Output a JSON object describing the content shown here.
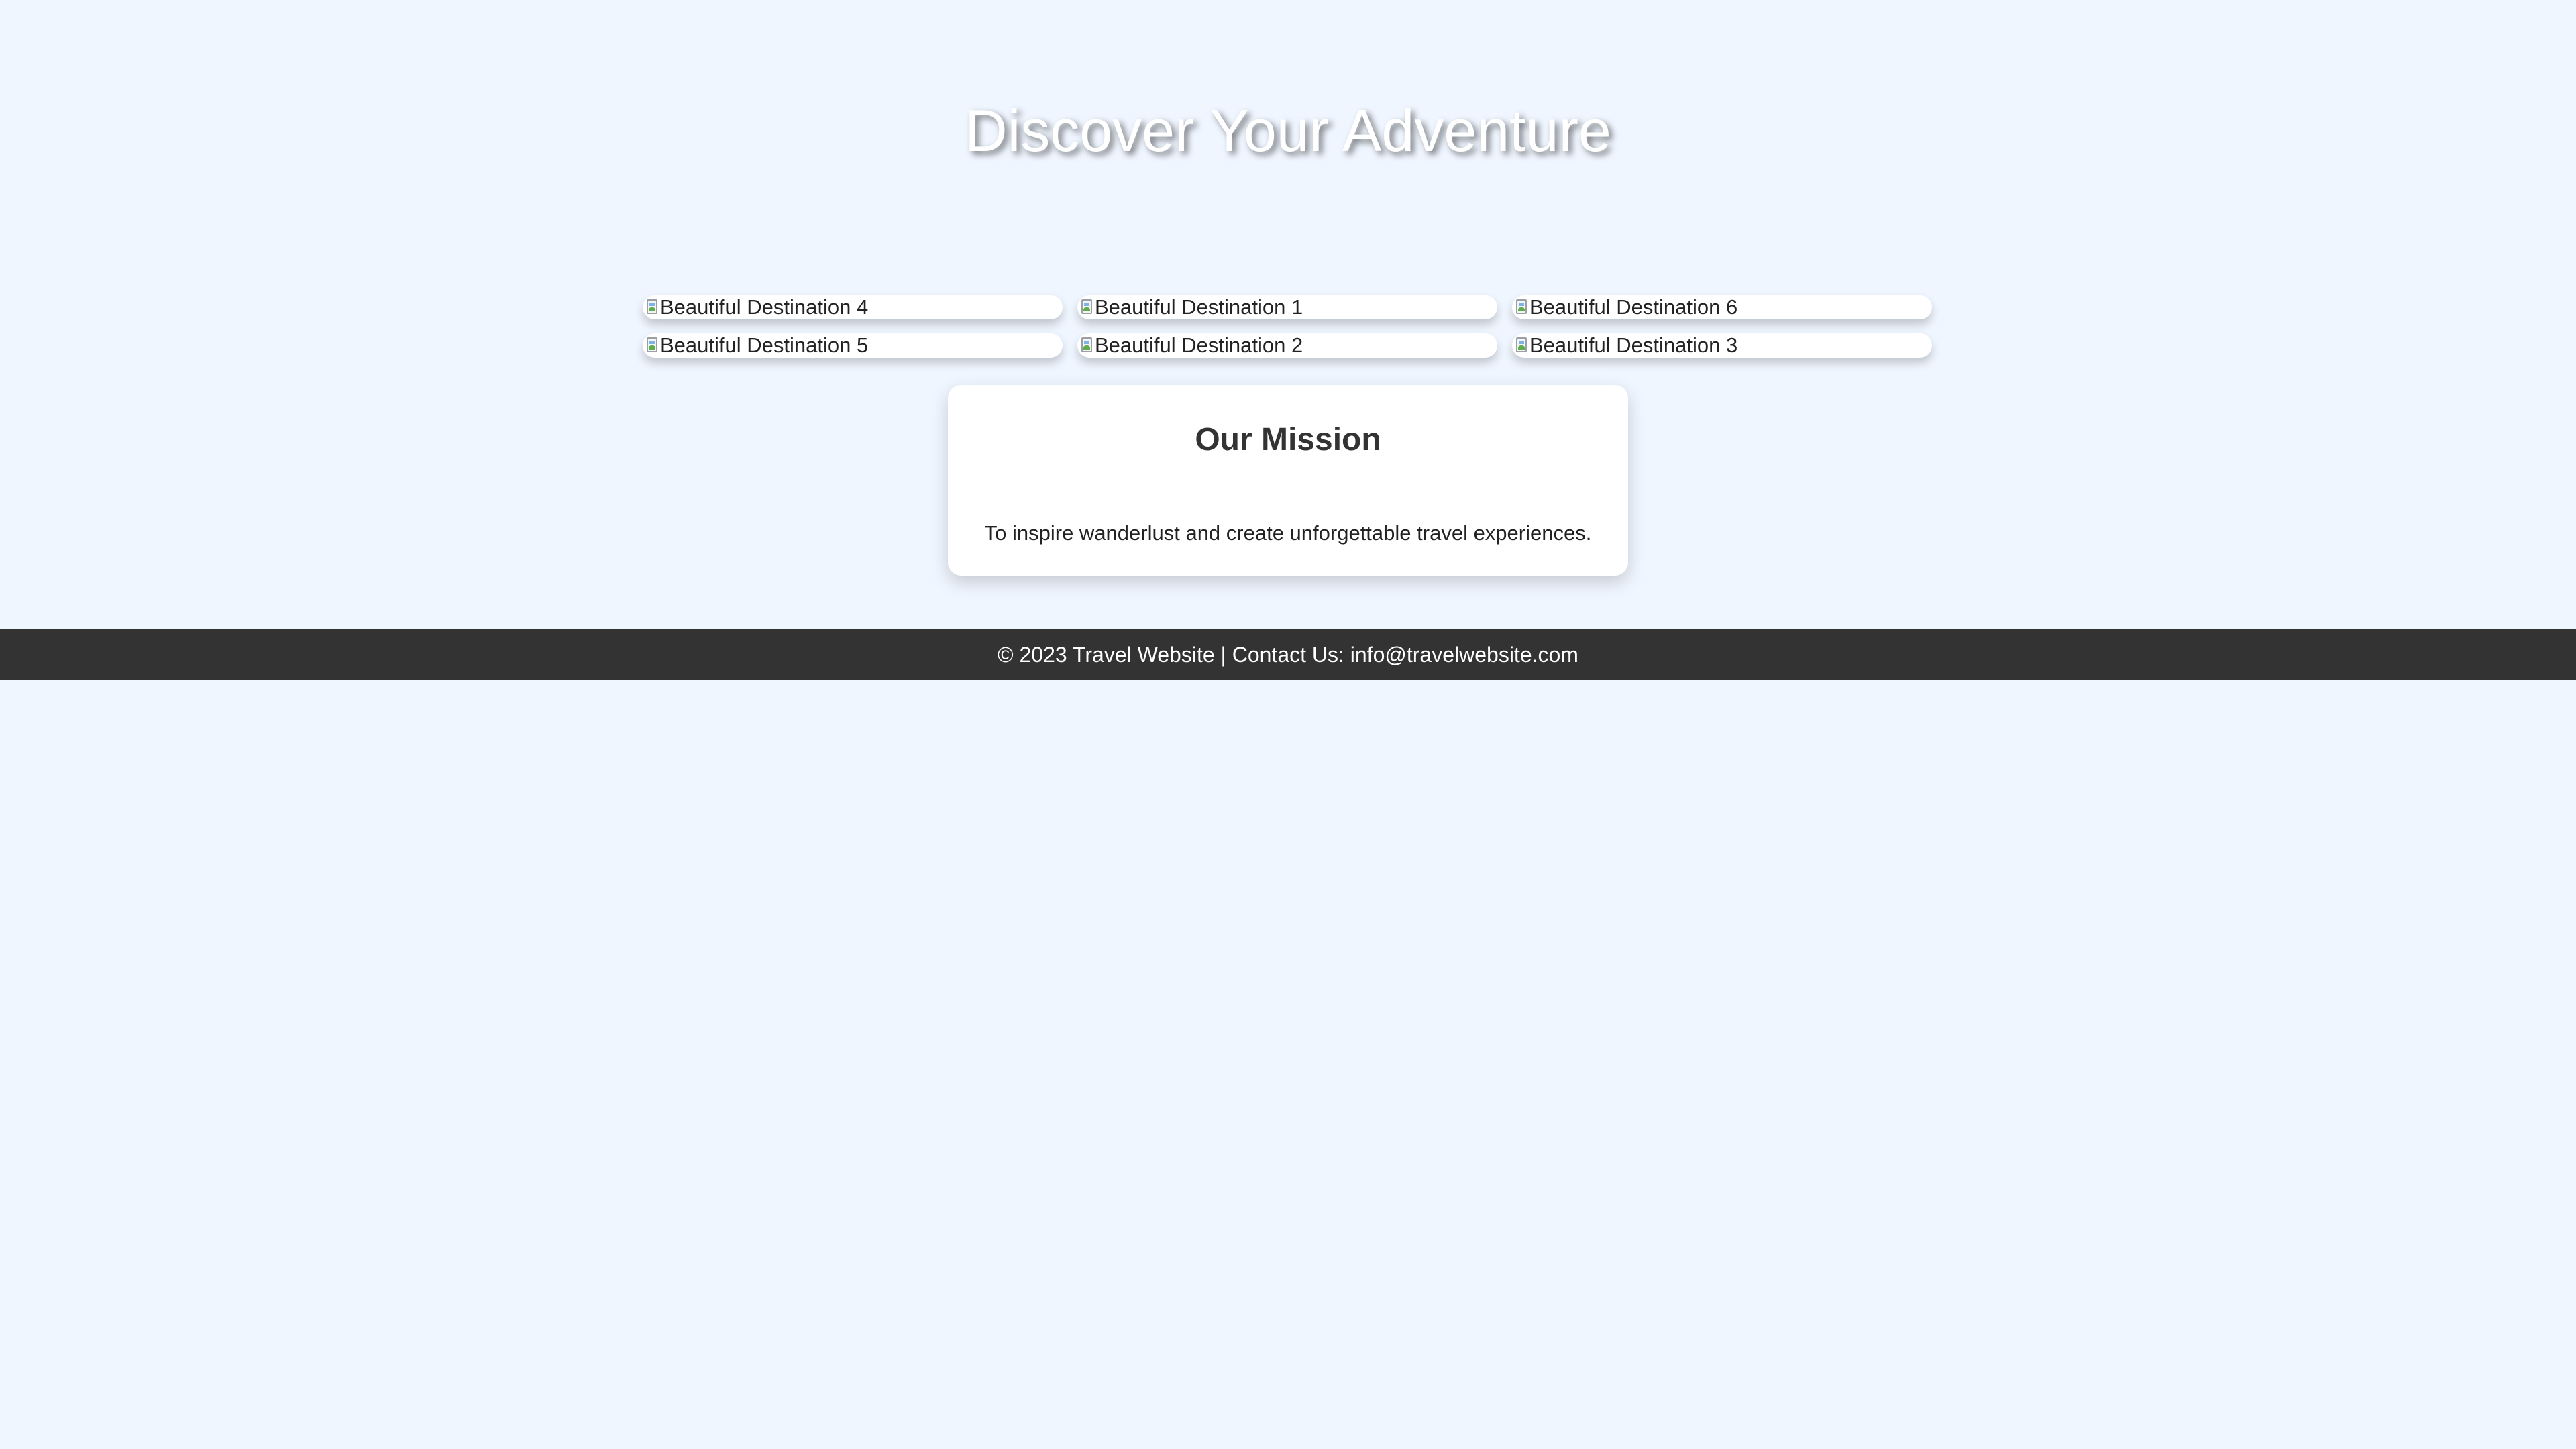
{
  "hero": {
    "title": "Discover Your Adventure"
  },
  "gallery": {
    "items": [
      {
        "alt": "Beautiful Destination 4",
        "icon": "broken-image-icon"
      },
      {
        "alt": "Beautiful Destination 1",
        "icon": "broken-image-icon"
      },
      {
        "alt": "Beautiful Destination 6",
        "icon": "broken-image-icon"
      },
      {
        "alt": "Beautiful Destination 5",
        "icon": "broken-image-icon"
      },
      {
        "alt": "Beautiful Destination 2",
        "icon": "broken-image-icon"
      },
      {
        "alt": "Beautiful Destination 3",
        "icon": "broken-image-icon"
      }
    ]
  },
  "mission": {
    "heading": "Our Mission",
    "text": "To inspire wanderlust and create unforgettable travel experiences."
  },
  "footer": {
    "text": "© 2023 Travel Website | Contact Us: info@travelwebsite.com"
  },
  "colors": {
    "page_background": "#f0f6ff",
    "card_background": "#ffffff",
    "footer_background": "#333333",
    "footer_text": "#ffffff",
    "heading_text": "#333333"
  }
}
